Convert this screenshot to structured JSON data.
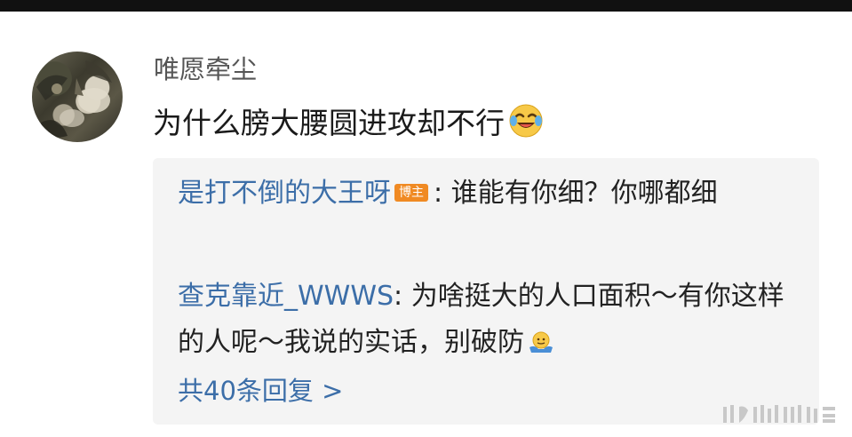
{
  "comment": {
    "username": "唯愿牵尘",
    "text": "为什么膀大腰圆进攻却不行",
    "emoji": "laughing-tears-emoji"
  },
  "replies": [
    {
      "author": "是打不倒的大王呀",
      "badge": "博主",
      "separator": ": ",
      "text": "谁能有你细？你哪都细"
    },
    {
      "author": "查克靠近_WWWS",
      "separator": ": ",
      "text": "为啥挺大的人口面积～有你这样的人呢～我说的实话，别破防",
      "emoji": "shrug-emoji"
    }
  ],
  "more_replies": "共40条回复 >",
  "colors": {
    "link": "#3c6ea8",
    "badge": "#f08a23",
    "reply_bg": "#f4f4f4"
  }
}
